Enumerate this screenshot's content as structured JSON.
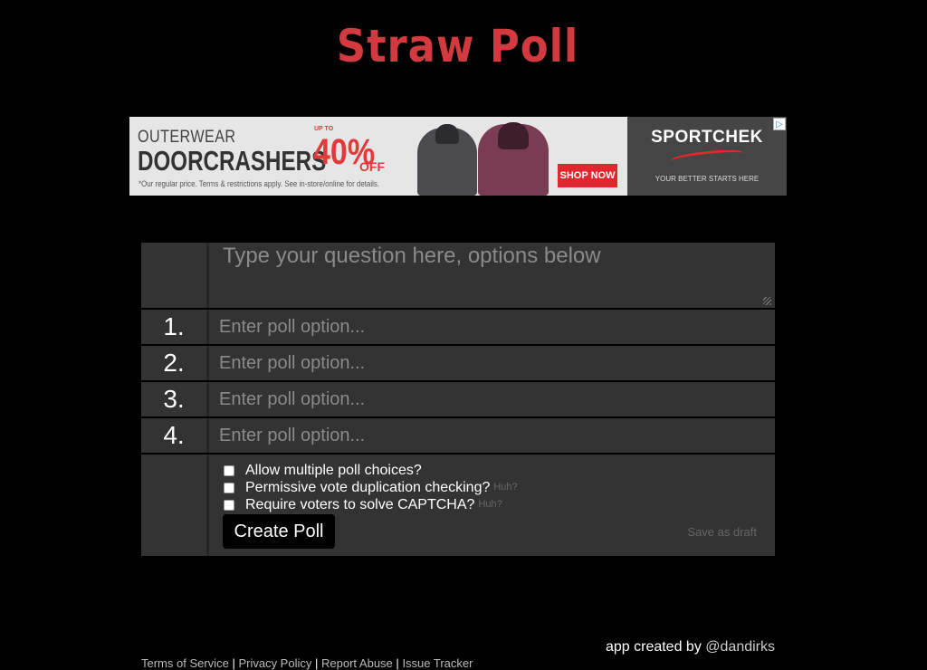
{
  "logo": {
    "text": "Straw Poll"
  },
  "ad": {
    "outerwear": "OUTERWEAR",
    "doorcrashers": "DOORCRASHERS",
    "upto": "UP TO",
    "percent": "40%",
    "off": "OFF",
    "fineprint": "*Our regular price. Terms & restrictions apply. See in-store/online for details.",
    "shop_now": "SHOP NOW",
    "brand": "SPORTCHEK",
    "tagline": "YOUR BETTER STARTS HERE",
    "adchoices": "▷"
  },
  "form": {
    "question_placeholder": "Type your question here, options below",
    "options": [
      {
        "number": "1.",
        "placeholder": "Enter poll option..."
      },
      {
        "number": "2.",
        "placeholder": "Enter poll option..."
      },
      {
        "number": "3.",
        "placeholder": "Enter poll option..."
      },
      {
        "number": "4.",
        "placeholder": "Enter poll option..."
      }
    ],
    "checkboxes": [
      {
        "label": "Allow multiple poll choices?",
        "huh": ""
      },
      {
        "label": "Permissive vote duplication checking?",
        "huh": "Huh?"
      },
      {
        "label": "Require voters to solve CAPTCHA?",
        "huh": "Huh?"
      }
    ],
    "create_button": "Create Poll",
    "save_draft": "Save as draft"
  },
  "credit": {
    "prefix": "app created by",
    "handle": "@dandirks"
  },
  "footer": {
    "links": [
      "Terms of Service",
      "Privacy Policy",
      "Report Abuse",
      "Issue Tracker"
    ],
    "separator": "|"
  },
  "colors": {
    "brand_red": "#d23a3f",
    "panel": "#333333",
    "background": "#000000"
  }
}
